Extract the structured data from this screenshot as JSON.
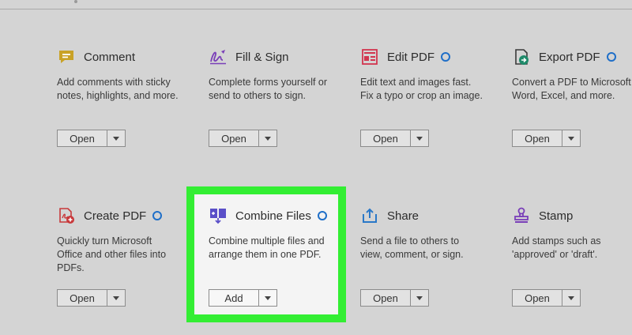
{
  "tools": [
    {
      "id": "comment",
      "title": "Comment",
      "desc": "Add comments with sticky\nnotes, highlights, and more.",
      "button": "Open",
      "badge": false,
      "icon": "comment-icon"
    },
    {
      "id": "fill-sign",
      "title": "Fill & Sign",
      "desc": "Complete forms yourself or\nsend to others to sign.",
      "button": "Open",
      "badge": false,
      "icon": "signature-pen-icon"
    },
    {
      "id": "edit-pdf",
      "title": "Edit PDF",
      "desc": "Edit text and images fast.\nFix a typo or crop an image.",
      "button": "Open",
      "badge": true,
      "icon": "edit-pdf-icon"
    },
    {
      "id": "export-pdf",
      "title": "Export PDF",
      "desc": "Convert a PDF to Microsoft\nWord, Excel, and more.",
      "button": "Open",
      "badge": true,
      "icon": "export-pdf-icon"
    },
    {
      "id": "create-pdf",
      "title": "Create PDF",
      "desc": "Quickly turn Microsoft\nOffice and other files into\nPDFs.",
      "button": "Open",
      "badge": true,
      "icon": "create-pdf-icon"
    },
    {
      "id": "combine-files",
      "title": "Combine Files",
      "desc": "Combine multiple files and\narrange them in one PDF.",
      "button": "Add",
      "badge": true,
      "icon": "combine-files-icon"
    },
    {
      "id": "share",
      "title": "Share",
      "desc": "Send a file to others to\nview, comment, or sign.",
      "button": "Open",
      "badge": false,
      "icon": "share-icon"
    },
    {
      "id": "stamp",
      "title": "Stamp",
      "desc": "Add stamps such as\n'approved' or 'draft'.",
      "button": "Open",
      "badge": false,
      "icon": "stamp-icon"
    }
  ],
  "colors": {
    "background": "#d4d4d4",
    "highlight": "#33ee33",
    "badge": "#1f6fc8",
    "comment": "#c9a227",
    "fill_sign": "#7a3fb8",
    "edit_pdf": "#d2354f",
    "export_pdf": "#1f8a6a",
    "create_pdf": "#c8383a",
    "combine": "#5a4fc8",
    "share": "#2a78c8",
    "stamp": "#7a3fb8"
  }
}
